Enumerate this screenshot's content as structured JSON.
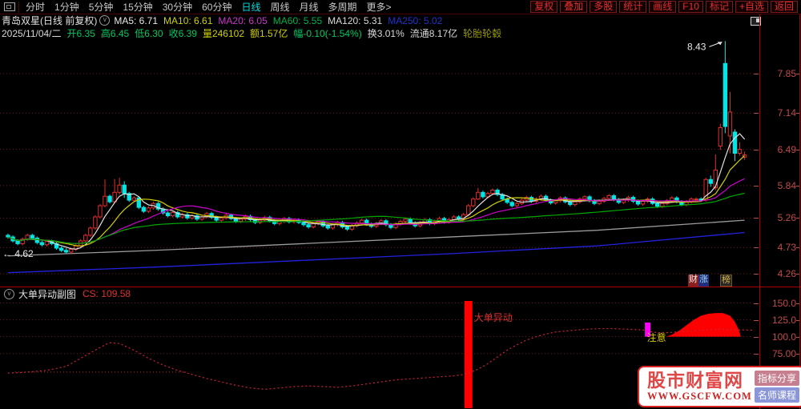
{
  "toolbar_left": {
    "items": [
      "分时",
      "1分钟",
      "5分钟",
      "15分钟",
      "30分钟",
      "60分钟",
      "日线",
      "周线",
      "月线",
      "多周期",
      "更多>"
    ],
    "active": "日线"
  },
  "toolbar_right": {
    "buttons": [
      "复权",
      "叠加",
      "多股",
      "统计",
      "画线",
      "F10",
      "标记",
      "+自选",
      "返回"
    ]
  },
  "title_row": {
    "symbol": "青岛双星(日线 前复权)",
    "mas": [
      {
        "text": "MA5: 6.71",
        "color": "#e8e8e8"
      },
      {
        "text": "MA10: 6.61",
        "color": "#cfcf00"
      },
      {
        "text": "MA20: 6.05",
        "color": "#cc33cc"
      },
      {
        "text": "MA60: 5.55",
        "color": "#00b050"
      },
      {
        "text": "MA120: 5.31",
        "color": "#d8d8d8"
      },
      {
        "text": "MA250: 5.02",
        "color": "#2233cc"
      }
    ]
  },
  "info_row": {
    "fields": [
      {
        "text": "2025/11/04/二",
        "color": "#d8d8d8"
      },
      {
        "text": "开6.35",
        "color": "#00c864"
      },
      {
        "text": "高6.45",
        "color": "#00c864"
      },
      {
        "text": "低6.30",
        "color": "#00c864"
      },
      {
        "text": "收6.39",
        "color": "#00c864"
      },
      {
        "text": "量246102",
        "color": "#cfcf00"
      },
      {
        "text": "额1.57亿",
        "color": "#cfcf00"
      },
      {
        "text": "幅-0.10(-1.54%)",
        "color": "#00c864"
      },
      {
        "text": "换3.01%",
        "color": "#d8d8d8"
      },
      {
        "text": "流通8.17亿",
        "color": "#d8d8d8"
      },
      {
        "text": "轮胎轮毂",
        "color": "#9a9a00"
      }
    ]
  },
  "corner_badges": [
    {
      "text": "财",
      "bg": "#8a1f1f",
      "color": "#eeeeee"
    },
    {
      "text": "涨",
      "bg": "#1f2d7a",
      "color": "#9fd7ff"
    },
    {
      "text": "榜",
      "bg": "#262626",
      "color": "#d9b24a"
    }
  ],
  "sub_header": {
    "title": "大单异动副图",
    "value_label": "CS: 109.58"
  },
  "watermark": {
    "site": "股市财富网",
    "url": "WWW.GSCFW.COM",
    "badges": [
      {
        "text": "指标分享",
        "bg": "#c57f8e"
      },
      {
        "text": "名师课程",
        "bg": "#8a96d8"
      }
    ]
  },
  "colors": {
    "up": "#e03030",
    "down": "#00e5e5",
    "grid": "#6b1a1a",
    "axis_text": "#c34a4a",
    "cs_line": "#d0203a",
    "signal_red": "#ff0000",
    "attention": "#ff00ff",
    "attention_text": "#d8c800"
  },
  "chart_data": [
    {
      "type": "candlestick",
      "title": "青岛双星 日线 前复权",
      "ylabel": "价格",
      "ylim": [
        4.06,
        8.45
      ],
      "y_axis_labels": [
        "7.85",
        "7.14",
        "6.49",
        "5.84",
        "5.26",
        "4.73",
        "4.26"
      ],
      "y_axis_values": [
        7.85,
        7.14,
        6.49,
        5.84,
        5.26,
        4.73,
        4.26
      ],
      "grid": true,
      "first_open": 4.95,
      "closes": [
        4.92,
        4.85,
        4.8,
        4.88,
        4.95,
        4.9,
        4.82,
        4.78,
        4.84,
        4.8,
        4.72,
        4.68,
        4.65,
        4.7,
        4.76,
        4.85,
        4.95,
        5.08,
        5.28,
        5.48,
        5.65,
        5.55,
        5.72,
        5.85,
        5.7,
        5.58,
        5.62,
        5.45,
        5.38,
        5.44,
        5.52,
        5.42,
        5.35,
        5.3,
        5.36,
        5.28,
        5.32,
        5.26,
        5.3,
        5.24,
        5.28,
        5.34,
        5.27,
        5.22,
        5.26,
        5.31,
        5.25,
        5.2,
        5.24,
        5.29,
        5.23,
        5.18,
        5.22,
        5.27,
        5.21,
        5.16,
        5.2,
        5.25,
        5.19,
        5.22,
        5.18,
        5.14,
        5.1,
        5.16,
        5.2,
        5.12,
        5.08,
        5.14,
        5.18,
        5.1,
        5.06,
        5.12,
        5.17,
        5.22,
        5.15,
        5.11,
        5.16,
        5.21,
        5.14,
        5.09,
        5.15,
        5.2,
        5.24,
        5.17,
        5.12,
        5.18,
        5.23,
        5.16,
        5.2,
        5.25,
        5.19,
        5.23,
        5.28,
        5.24,
        5.32,
        5.48,
        5.6,
        5.72,
        5.64,
        5.7,
        5.76,
        5.68,
        5.6,
        5.54,
        5.48,
        5.52,
        5.58,
        5.63,
        5.56,
        5.6,
        5.65,
        5.58,
        5.53,
        5.57,
        5.62,
        5.55,
        5.5,
        5.55,
        5.6,
        5.64,
        5.57,
        5.52,
        5.56,
        5.61,
        5.66,
        5.59,
        5.54,
        5.58,
        5.63,
        5.56,
        5.51,
        5.56,
        5.6,
        5.52,
        5.47,
        5.52,
        5.57,
        5.62,
        5.55,
        5.5,
        5.55,
        5.6,
        5.6,
        5.58,
        5.95,
        5.88,
        6.12,
        6.88,
        6.9,
        7.16,
        6.42,
        6.49,
        6.39
      ],
      "ohlc_overrides": {
        "12": [
          4.68,
          4.72,
          4.62,
          4.65
        ],
        "20": [
          5.48,
          5.95,
          5.45,
          5.65
        ],
        "22": [
          5.55,
          5.96,
          5.52,
          5.72
        ],
        "23": [
          5.72,
          5.98,
          5.68,
          5.85
        ],
        "24": [
          5.85,
          5.92,
          5.62,
          5.7
        ],
        "97": [
          5.6,
          5.8,
          5.58,
          5.72
        ],
        "144": [
          5.58,
          5.98,
          5.55,
          5.95
        ],
        "145": [
          5.95,
          6.02,
          5.82,
          5.88
        ],
        "146": [
          5.8,
          6.4,
          5.76,
          6.12
        ],
        "147": [
          6.55,
          6.95,
          6.48,
          6.88
        ],
        "148": [
          8.03,
          8.43,
          6.78,
          6.9
        ],
        "149": [
          6.73,
          7.52,
          6.42,
          7.16
        ],
        "150": [
          6.8,
          6.85,
          6.28,
          6.42
        ],
        "151": [
          6.42,
          6.62,
          6.38,
          6.49
        ],
        "152": [
          6.35,
          6.45,
          6.3,
          6.39
        ]
      },
      "ma_windows": [
        {
          "n": 5,
          "color": "#e0e0e0"
        },
        {
          "n": 10,
          "color": "#cfcf00"
        },
        {
          "n": 20,
          "color": "#cc00cc"
        },
        {
          "n": 60,
          "color": "#00a800"
        }
      ],
      "ma_long": [
        {
          "name": "MA120",
          "color": "#9a9a9a",
          "points": [
            [
              0,
              4.58
            ],
            [
              0.2,
              4.68
            ],
            [
              0.4,
              4.8
            ],
            [
              0.6,
              4.92
            ],
            [
              0.8,
              5.04
            ],
            [
              1,
              5.22
            ]
          ]
        },
        {
          "name": "MA250",
          "color": "#2222dd",
          "points": [
            [
              0,
              4.28
            ],
            [
              0.2,
              4.38
            ],
            [
              0.4,
              4.5
            ],
            [
              0.6,
              4.62
            ],
            [
              0.8,
              4.76
            ],
            [
              1,
              5.0
            ]
          ]
        }
      ],
      "annotation_high": {
        "text": "8.43",
        "day": 148,
        "value": 8.43
      },
      "annotation_low": {
        "text": "← 4.62"
      }
    },
    {
      "type": "line",
      "title": "大单异动副图",
      "latest_label": "CS: 109.58",
      "ylim": [
        -6,
        153
      ],
      "y_axis_labels": [
        "150.0",
        "125.0",
        "100.0",
        "75.00"
      ],
      "y_axis_values": [
        150,
        125,
        100,
        75
      ],
      "grid": true,
      "series": [
        {
          "name": "CS",
          "points": [
            [
              0,
              46
            ],
            [
              3,
              47
            ],
            [
              8,
              50
            ],
            [
              12,
              56
            ],
            [
              15,
              68
            ],
            [
              18,
              80
            ],
            [
              20,
              88
            ],
            [
              21,
              91
            ],
            [
              23,
              90
            ],
            [
              26,
              80
            ],
            [
              29,
              68
            ],
            [
              32,
              58
            ],
            [
              35,
              50
            ],
            [
              38,
              44
            ],
            [
              41,
              38
            ],
            [
              44,
              33
            ],
            [
              47,
              28
            ],
            [
              50,
              24
            ],
            [
              53,
              22
            ],
            [
              56,
              24
            ],
            [
              59,
              26
            ],
            [
              62,
              27
            ],
            [
              65,
              26
            ],
            [
              68,
              25
            ],
            [
              71,
              27
            ],
            [
              74,
              30
            ],
            [
              77,
              33
            ],
            [
              80,
              36
            ],
            [
              84,
              38
            ],
            [
              88,
              40
            ],
            [
              92,
              42
            ],
            [
              94,
              44
            ],
            [
              95,
              46
            ],
            [
              97,
              52
            ],
            [
              99,
              60
            ],
            [
              101,
              70
            ],
            [
              103,
              80
            ],
            [
              105,
              88
            ],
            [
              107,
              95
            ],
            [
              109,
              100
            ],
            [
              111,
              104
            ],
            [
              113,
              107
            ],
            [
              116,
              109
            ],
            [
              119,
              111
            ],
            [
              122,
              112
            ],
            [
              125,
              112
            ],
            [
              128,
              111
            ],
            [
              131,
              110
            ],
            [
              132,
              108
            ],
            [
              134,
              106
            ],
            [
              136,
              106
            ],
            [
              138,
              107
            ],
            [
              140,
              108
            ],
            [
              142,
              109
            ],
            [
              144,
              110
            ],
            [
              146,
              111
            ],
            [
              148,
              111
            ],
            [
              150,
              110
            ],
            [
              152,
              110
            ],
            [
              154,
              109.6
            ]
          ]
        }
      ],
      "baseline_segment": {
        "from_day": 1.5,
        "to_day": 37,
        "value": 47.5
      },
      "signal_bar": {
        "day": 95,
        "label": "大单异动"
      },
      "attention_bar": {
        "day": 132,
        "from": 100,
        "to": 121,
        "label": "注意"
      },
      "mountain": {
        "baseline": 100,
        "points": [
          [
            135.8,
            100
          ],
          [
            137,
            103
          ],
          [
            138.5,
            109
          ],
          [
            140,
            117
          ],
          [
            141.5,
            125
          ],
          [
            143,
            131
          ],
          [
            144.5,
            134
          ],
          [
            146,
            135
          ],
          [
            147.5,
            135
          ],
          [
            149,
            131
          ],
          [
            150,
            122
          ],
          [
            150.8,
            110
          ],
          [
            151.2,
            100
          ]
        ]
      }
    }
  ]
}
